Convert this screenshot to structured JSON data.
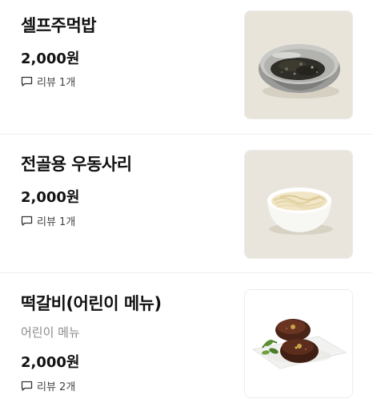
{
  "items": [
    {
      "name": "셀프주먹밥",
      "price": "2,000원",
      "review_label": "리뷰 1개",
      "image": "seasoned-rice-in-steel-bowl-photo"
    },
    {
      "name": "전골용 우동사리",
      "price": "2,000원",
      "review_label": "리뷰 1개",
      "image": "udon-noodles-in-white-bowl-photo"
    },
    {
      "name": "떡갈비(어린이 메뉴)",
      "description": "어린이 메뉴",
      "price": "2,000원",
      "review_label": "리뷰 2개",
      "image": "tteokgalbi-patties-on-plate-photo"
    }
  ],
  "colors": {
    "text": "#111111",
    "muted": "#8a8a8a",
    "divider": "#efefef",
    "thumb_bg": "#e9e5dc"
  }
}
